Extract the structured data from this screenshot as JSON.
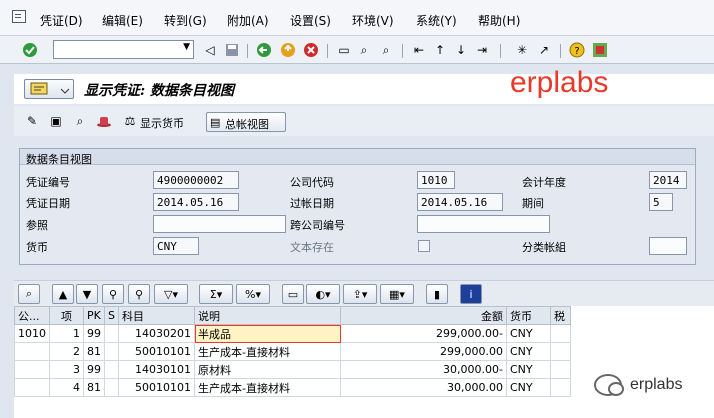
{
  "menu": {
    "items": [
      "凭证(D)",
      "编辑(E)",
      "转到(G)",
      "附加(A)",
      "设置(S)",
      "环境(V)",
      "系统(Y)",
      "帮助(H)"
    ]
  },
  "toolbar": {
    "icons": [
      "enter-icon",
      "back-icon",
      "save-icon",
      "green-back-icon",
      "exit-icon",
      "cancel-icon",
      "print-icon",
      "find-icon",
      "find-next-icon",
      "first-page-icon",
      "prev-page-icon",
      "next-page-icon",
      "last-page-icon",
      "new-session-icon",
      "shortcut-icon",
      "help-icon",
      "customize-layout-icon"
    ]
  },
  "title": {
    "text": "显示凭证: 数据条目视图"
  },
  "watermark": {
    "text": "erplabs"
  },
  "app_toolbar": {
    "display_currency_label": "显示货币",
    "general_ledger_view_label": "总帐视图"
  },
  "header_group": {
    "title": "数据条目视图",
    "doc_number_label": "凭证编号",
    "doc_number": "4900000002",
    "company_code_label": "公司代码",
    "company_code": "1010",
    "fiscal_year_label": "会计年度",
    "fiscal_year": "2014",
    "doc_date_label": "凭证日期",
    "doc_date": "2014.05.16",
    "posting_date_label": "过帐日期",
    "posting_date": "2014.05.16",
    "period_label": "期间",
    "period": "5",
    "reference_label": "参照",
    "reference": "",
    "cross_cc_label": "跨公司编号",
    "cross_cc": "",
    "currency_label": "货币",
    "currency": "CNY",
    "text_exists_label": "文本存在",
    "ledger_group_label": "分类帐組",
    "ledger_group": ""
  },
  "table": {
    "headers": [
      "公...",
      "项",
      "PK",
      "S",
      "科目",
      "说明",
      "金额",
      "货币",
      "税"
    ],
    "rows": [
      {
        "cc": "1010",
        "item": "1",
        "pk": "99",
        "s": "",
        "account": "14030201",
        "desc": "半成品",
        "amount": "299,000.00-",
        "curr": "CNY",
        "tax": ""
      },
      {
        "cc": "",
        "item": "2",
        "pk": "81",
        "s": "",
        "account": "50010101",
        "desc": "生产成本-直接材料",
        "amount": "299,000.00",
        "curr": "CNY",
        "tax": ""
      },
      {
        "cc": "",
        "item": "3",
        "pk": "99",
        "s": "",
        "account": "14030101",
        "desc": "原材料",
        "amount": "30,000.00-",
        "curr": "CNY",
        "tax": ""
      },
      {
        "cc": "",
        "item": "4",
        "pk": "81",
        "s": "",
        "account": "50010101",
        "desc": "生产成本-直接材料",
        "amount": "30,000.00",
        "curr": "CNY",
        "tax": ""
      }
    ]
  },
  "footer_watermark": {
    "text": "erplabs"
  }
}
